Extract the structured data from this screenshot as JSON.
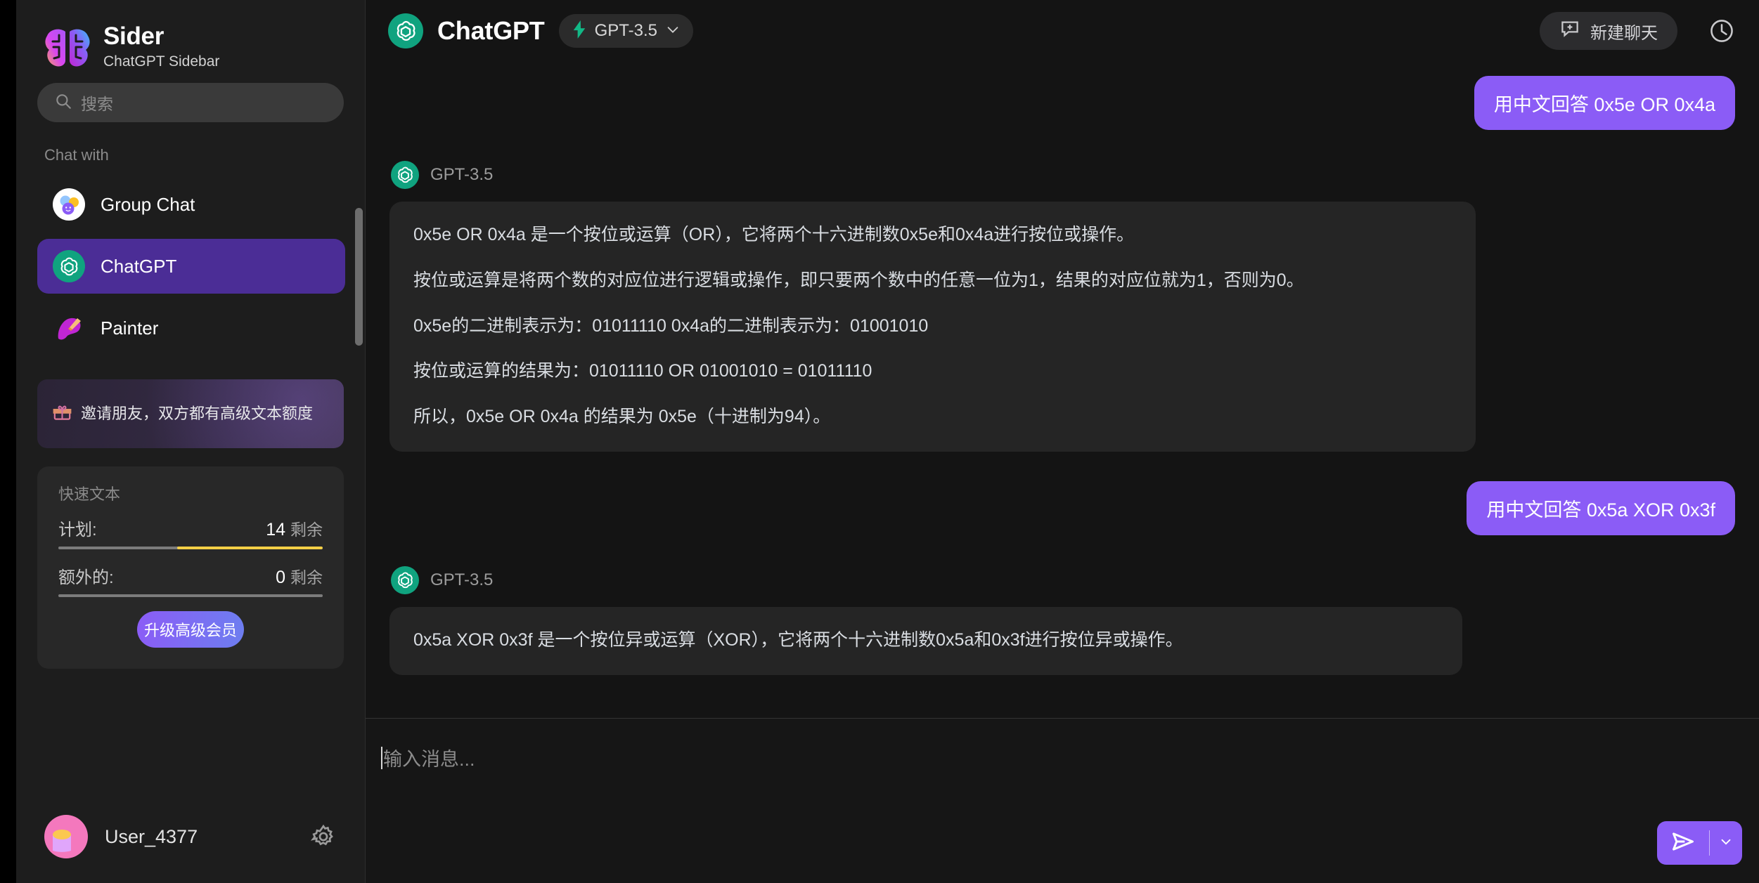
{
  "brand": {
    "title": "Sider",
    "subtitle": "ChatGPT Sidebar",
    "logo_icon": "brain-icon"
  },
  "search": {
    "placeholder": "搜索",
    "icon": "search-icon"
  },
  "sidebar": {
    "section_label": "Chat with",
    "items": [
      {
        "label": "Group Chat",
        "icon": "group-chat-avatar-icon",
        "active": false
      },
      {
        "label": "ChatGPT",
        "icon": "chatgpt-avatar-icon",
        "active": true
      },
      {
        "label": "Painter",
        "icon": "painter-avatar-icon",
        "active": false
      }
    ],
    "promo": {
      "icon": "gift-icon",
      "text": "邀请朋友，双方都有高级文本额度"
    },
    "quota": {
      "title": "快速文本",
      "rows": [
        {
          "label": "计划:",
          "value": "14",
          "unit": "剩余",
          "fill_percent": 55,
          "fill_color": "#f4cf46"
        },
        {
          "label": "额外的:",
          "value": "0",
          "unit": "剩余",
          "fill_percent": 0,
          "fill_color": "#f4cf46"
        }
      ],
      "upgrade_label": "升级高级会员"
    },
    "user": {
      "name": "User_4377",
      "avatar_icon": "user-avatar-icon",
      "settings_icon": "gear-icon"
    }
  },
  "header": {
    "logo_icon": "chatgpt-logo-icon",
    "title": "ChatGPT",
    "model": {
      "icon": "lightning-bolt-icon",
      "name": "GPT-3.5",
      "chevron": "chevron-down-icon"
    },
    "new_chat": {
      "icon": "new-chat-icon",
      "label": "新建聊天"
    },
    "history_icon": "clock-history-icon"
  },
  "conversation": [
    {
      "role": "user",
      "text": "用中文回答 0x5e OR 0x4a"
    },
    {
      "role": "assistant",
      "name": "GPT-3.5",
      "avatar_icon": "chatgpt-logo-icon",
      "paragraphs": [
        "0x5e OR 0x4a 是一个按位或运算（OR），它将两个十六进制数0x5e和0x4a进行按位或操作。",
        "按位或运算是将两个数的对应位进行逻辑或操作，即只要两个数中的任意一位为1，结果的对应位就为1，否则为0。",
        "0x5e的二进制表示为：01011110 0x4a的二进制表示为：01001010",
        "按位或运算的结果为：01011110 OR 01001010 = 01011110",
        "所以，0x5e OR 0x4a 的结果为 0x5e（十进制为94）。"
      ]
    },
    {
      "role": "user",
      "text": "用中文回答 0x5a XOR 0x3f"
    },
    {
      "role": "assistant",
      "name": "GPT-3.5",
      "avatar_icon": "chatgpt-logo-icon",
      "paragraphs": [
        "0x5a XOR 0x3f 是一个按位异或运算（XOR），它将两个十六进制数0x5a和0x3f进行按位异或操作。"
      ]
    }
  ],
  "composer": {
    "placeholder": "输入消息...",
    "send_icon": "send-plane-icon",
    "send_more_icon": "chevron-down-icon"
  },
  "colors": {
    "accent_purple": "#8b5cf6",
    "active_item": "#4b2d96",
    "sidebar_bg": "#1d1d1d",
    "main_bg": "#141414",
    "bubble_ai_bg": "#252525",
    "quota_fill": "#f4cf46",
    "chatgpt_green": "#10a37f"
  }
}
